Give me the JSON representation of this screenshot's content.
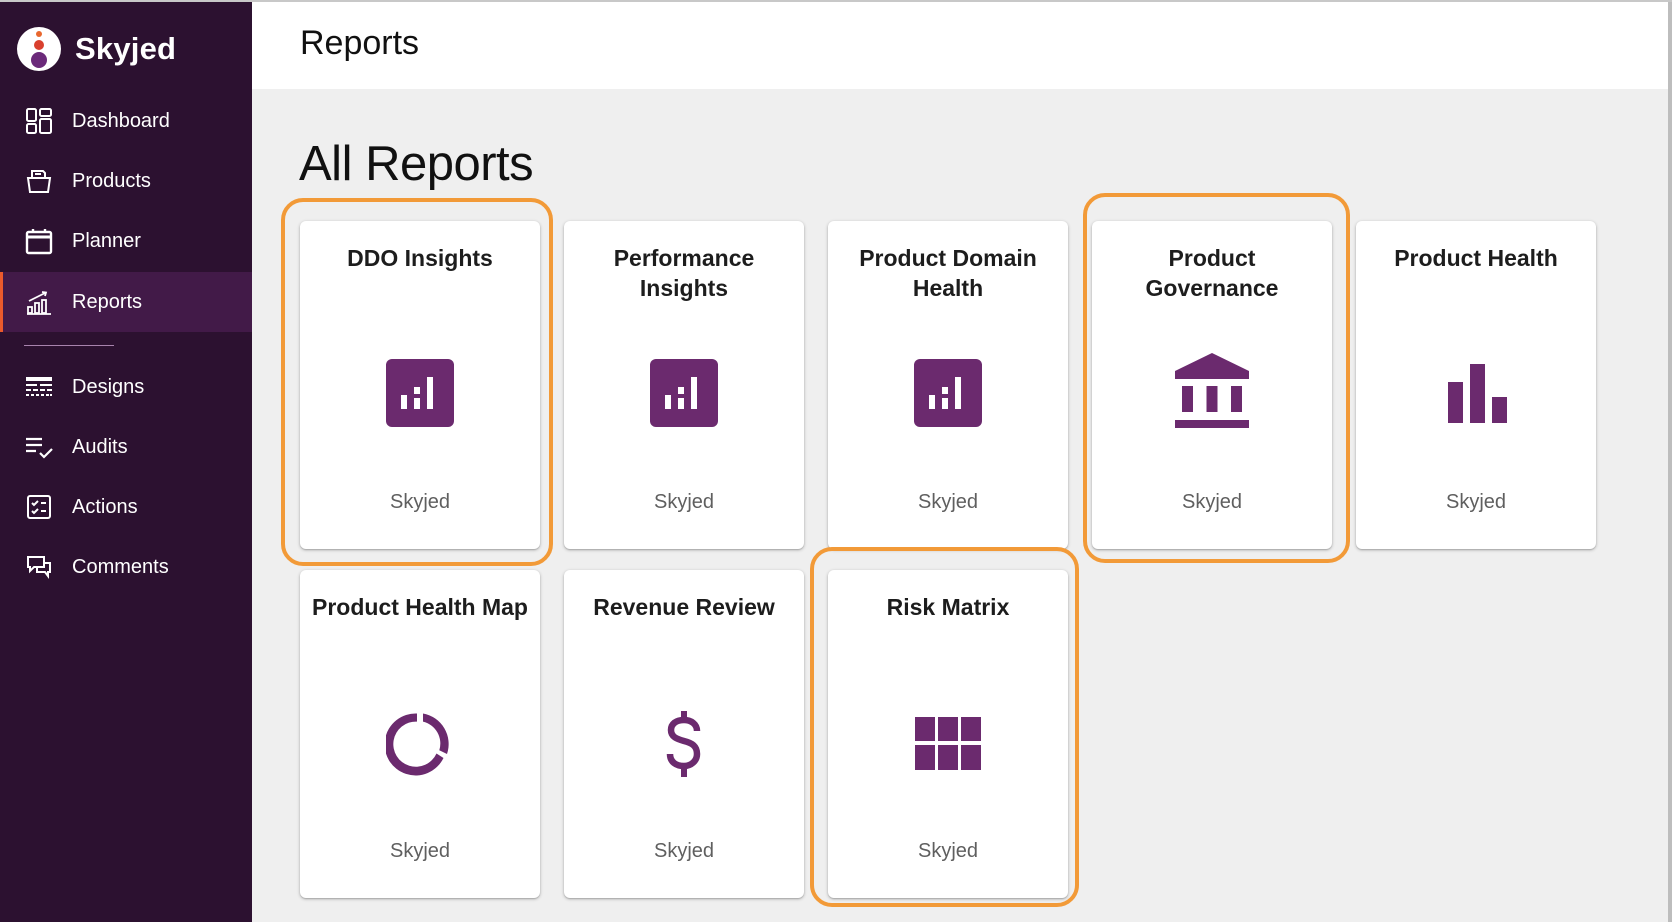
{
  "app": {
    "brand": "Skyjed",
    "colors": {
      "sidebar_bg": "#2c1130",
      "sidebar_active_bg": "#421a48",
      "active_indicator": "#ea5a2c",
      "icon_purple": "#6b2a6e",
      "highlight_outline": "#f29a38"
    }
  },
  "sidebar": {
    "items": [
      {
        "label": "Dashboard",
        "icon": "dashboard-icon",
        "active": false
      },
      {
        "label": "Products",
        "icon": "products-folder-icon",
        "active": false
      },
      {
        "label": "Planner",
        "icon": "calendar-icon",
        "active": false
      },
      {
        "label": "Reports",
        "icon": "trending-chart-icon",
        "active": true
      },
      {
        "label": "Designs",
        "icon": "designs-grid-icon",
        "active": false
      },
      {
        "label": "Audits",
        "icon": "checklist-icon",
        "active": false
      },
      {
        "label": "Actions",
        "icon": "task-checklist-icon",
        "active": false
      },
      {
        "label": "Comments",
        "icon": "comments-icon",
        "active": false
      }
    ]
  },
  "header": {
    "title": "Reports"
  },
  "main": {
    "title": "All Reports",
    "reports": [
      {
        "title": "DDO Insights",
        "icon": "bar-chart-box-icon",
        "source": "Skyjed",
        "highlighted": true
      },
      {
        "title": "Performance Insights",
        "icon": "bar-chart-box-icon",
        "source": "Skyjed",
        "highlighted": false
      },
      {
        "title": "Product Domain Health",
        "icon": "bar-chart-box-icon",
        "source": "Skyjed",
        "highlighted": false
      },
      {
        "title": "Product Governance",
        "icon": "bank-building-icon",
        "source": "Skyjed",
        "highlighted": true
      },
      {
        "title": "Product Health",
        "icon": "bar-chart-icon",
        "source": "Skyjed",
        "highlighted": false
      },
      {
        "title": "Product Health Map",
        "icon": "donut-chart-icon",
        "source": "Skyjed",
        "highlighted": false
      },
      {
        "title": "Revenue Review",
        "icon": "dollar-icon",
        "source": "Skyjed",
        "highlighted": false
      },
      {
        "title": "Risk Matrix",
        "icon": "grid-matrix-icon",
        "source": "Skyjed",
        "highlighted": true
      }
    ]
  }
}
